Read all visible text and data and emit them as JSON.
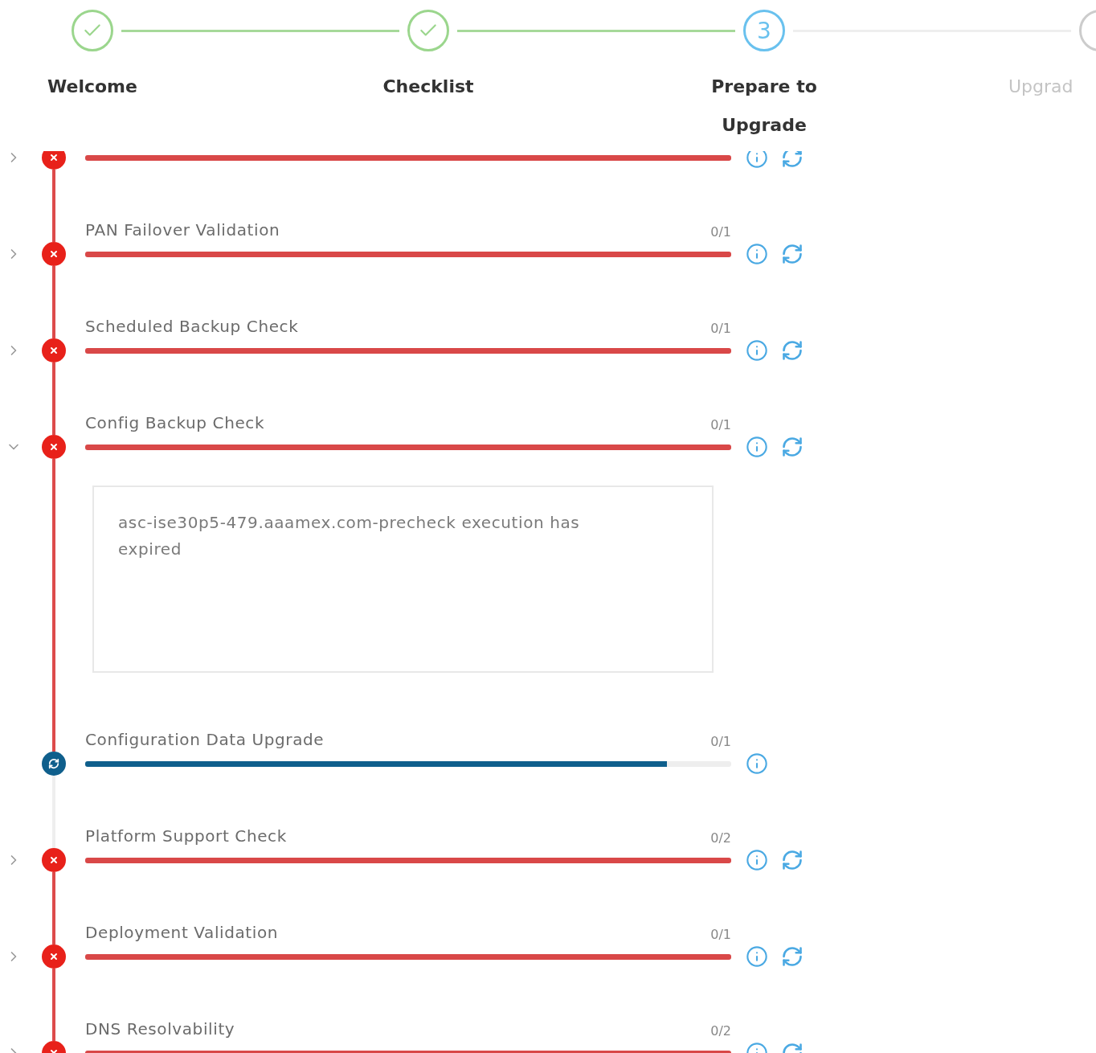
{
  "steps": [
    {
      "label": "Welcome",
      "kind": "done"
    },
    {
      "label": "Checklist",
      "kind": "done"
    },
    {
      "label": "Prepare to Upgrade",
      "kind": "current",
      "number": "3"
    },
    {
      "label": "Upgrad",
      "kind": "pending"
    }
  ],
  "checks": [
    {
      "kind": "failed",
      "expanded": false,
      "level": 1,
      "retry": true
    },
    {
      "title": "PAN Failover Validation",
      "count": "0/1",
      "kind": "failed",
      "expanded": false,
      "level": 1,
      "retry": true
    },
    {
      "title": "Scheduled Backup Check",
      "count": "0/1",
      "kind": "failed",
      "expanded": false,
      "level": 1,
      "retry": true
    },
    {
      "title": "Config Backup Check",
      "count": "0/1",
      "kind": "failed",
      "expanded": true,
      "level": 1,
      "retry": true,
      "message": "asc-ise30p5-479.aaamex.com-precheck execution has expired"
    },
    {
      "title": "Configuration Data Upgrade",
      "count": "0/1",
      "kind": "running",
      "level": 0.9,
      "retry": false
    },
    {
      "title": "Platform Support Check",
      "count": "0/2",
      "kind": "failed",
      "expanded": false,
      "level": 1,
      "retry": true
    },
    {
      "title": "Deployment Validation",
      "count": "0/1",
      "kind": "failed",
      "expanded": false,
      "level": 1,
      "retry": true
    },
    {
      "title": "DNS Resolvability",
      "count": "0/2",
      "kind": "failed",
      "expanded": false,
      "level": 1,
      "retry": true
    }
  ]
}
